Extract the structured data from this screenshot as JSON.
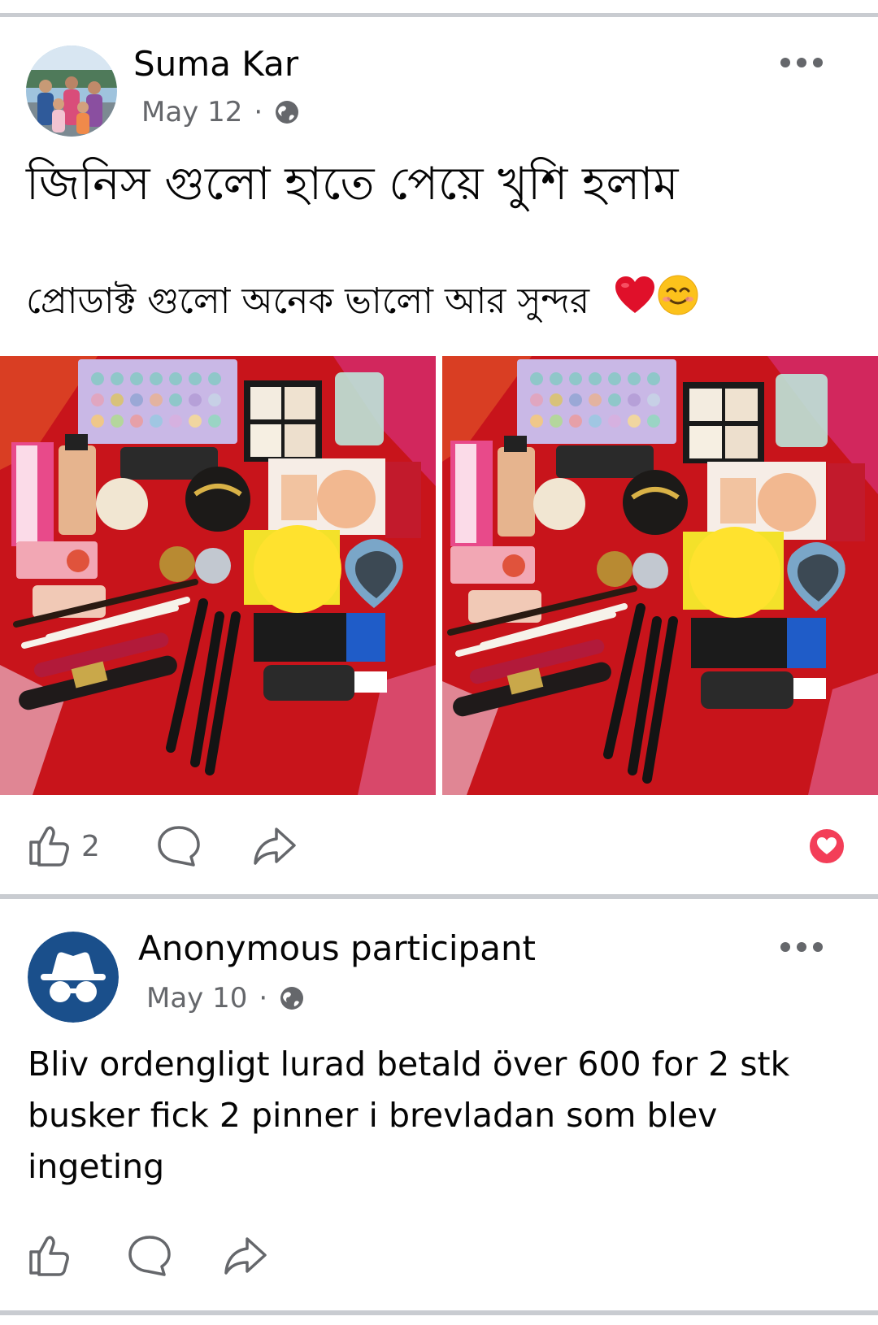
{
  "posts": [
    {
      "author": "Suma Kar",
      "date": "May 12",
      "separator": "·",
      "privacy_icon": "globe-icon",
      "headline": "জিনিস  গুলো হাতে পেয়ে খুশি হলাম",
      "body": "প্রোডাক্ট গুলো অনেক ভালো আর সুন্দর",
      "emojis": [
        "red-heart-emoji",
        "smiling-face-emoji"
      ],
      "photos": [
        "makeup-products-photo-1",
        "makeup-products-photo-2"
      ],
      "like_count": "2",
      "reaction_icon": "heart-reaction-icon",
      "reaction_color": "#f33e58"
    },
    {
      "author": "Anonymous participant",
      "date": "May 10",
      "separator": "·",
      "privacy_icon": "globe-icon",
      "body": "Bliv ordengligt lurad betald över 600 for 2 stk busker fick 2 pinner i brevladan som blev ingeting",
      "avatar_color": "#1a4f8b"
    }
  ],
  "icons": {
    "like": "thumbs-up-icon",
    "comment": "comment-icon",
    "share": "share-icon",
    "more": "more-options-icon"
  }
}
